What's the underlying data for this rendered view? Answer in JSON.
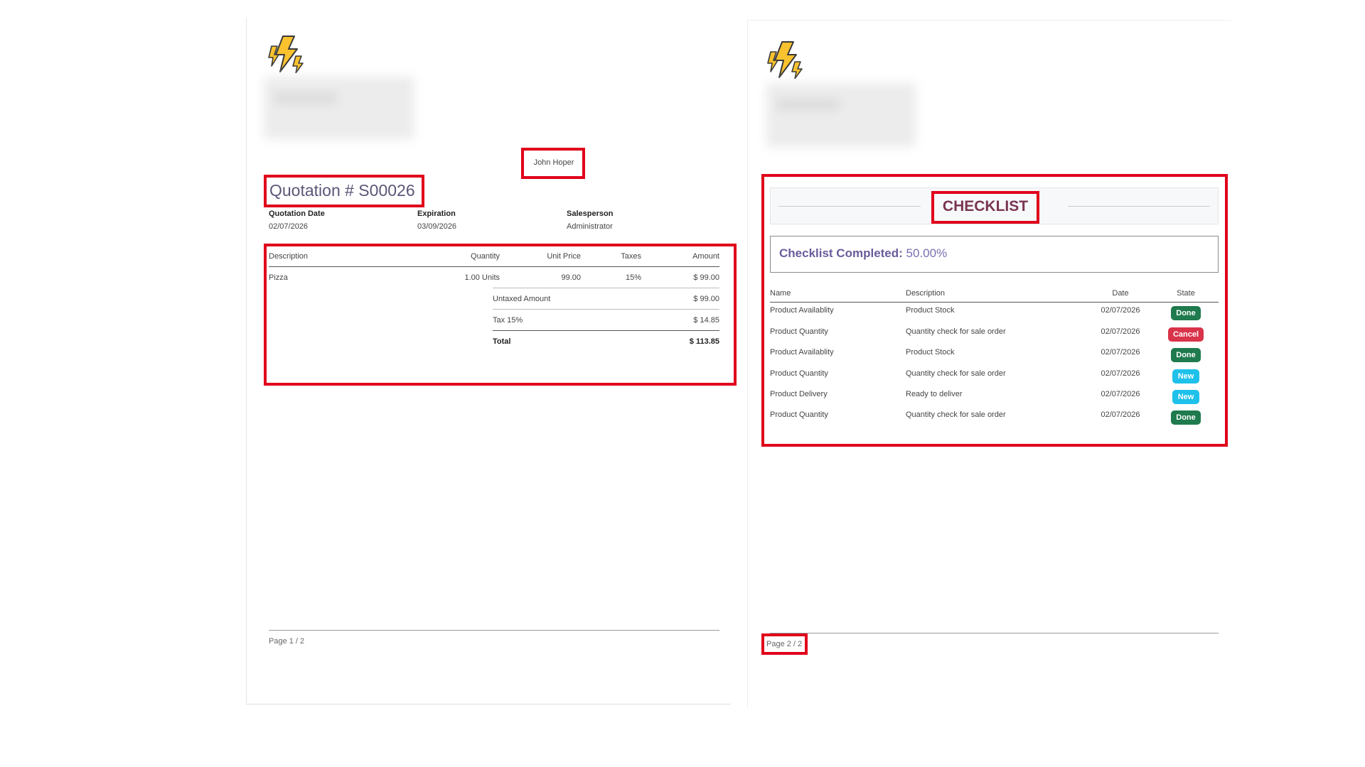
{
  "page1": {
    "logo": "lightning-logo-icon",
    "customer_name": "John Hoper",
    "title": "Quotation # S00026",
    "meta": [
      {
        "label": "Quotation Date",
        "value": "02/07/2026"
      },
      {
        "label": "Expiration",
        "value": "03/09/2026"
      },
      {
        "label": "Salesperson",
        "value": "Administrator"
      }
    ],
    "table": {
      "headers": {
        "description": "Description",
        "quantity": "Quantity",
        "unit_price": "Unit Price",
        "taxes": "Taxes",
        "amount": "Amount"
      },
      "rows": [
        {
          "description": "Pizza",
          "quantity": "1.00 Units",
          "unit_price": "99.00",
          "taxes": "15%",
          "amount": "$ 99.00"
        }
      ]
    },
    "totals": {
      "untaxed_label": "Untaxed Amount",
      "untaxed_value": "$ 99.00",
      "tax_label": "Tax 15%",
      "tax_value": "$ 14.85",
      "total_label": "Total",
      "total_value": "$ 113.85"
    },
    "footer": "Page 1 / 2"
  },
  "page2": {
    "logo": "lightning-logo-icon",
    "checklist_title": "CHECKLIST",
    "completed_label": "Checklist Completed:",
    "completed_value": "50.00%",
    "headers": {
      "name": "Name",
      "description": "Description",
      "date": "Date",
      "state": "State"
    },
    "rows": [
      {
        "name": "Product Availablity",
        "description": "Product Stock",
        "date": "02/07/2026",
        "state": "Done"
      },
      {
        "name": "Product Quantity",
        "description": "Quantity check for sale order",
        "date": "02/07/2026",
        "state": "Cancel"
      },
      {
        "name": "Product Availablity",
        "description": "Product Stock",
        "date": "02/07/2026",
        "state": "Done"
      },
      {
        "name": "Product Quantity",
        "description": "Quantity check for sale order",
        "date": "02/07/2026",
        "state": "New"
      },
      {
        "name": "Product Delivery",
        "description": "Ready to deliver",
        "date": "02/07/2026",
        "state": "New"
      },
      {
        "name": "Product Quantity",
        "description": "Quantity check for sale order",
        "date": "02/07/2026",
        "state": "Done"
      }
    ],
    "footer": "Page 2 / 2"
  },
  "colors": {
    "highlight_border": "#e0001b",
    "done": "#1f7a4d",
    "cancel": "#d9344a",
    "new": "#1ec1ea",
    "title_text": "#5b5677",
    "checklist_title": "#7a3552",
    "completed_text": "#6a5c9a"
  }
}
